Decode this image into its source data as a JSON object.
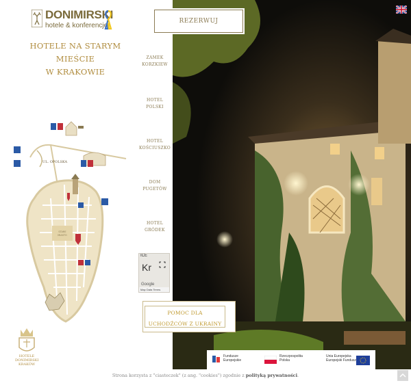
{
  "brand": {
    "name": "DONIMIRSKI",
    "tagline": "hotele & konferencje",
    "headline_line1": "HOTELE NA STARYM MIEŚCIE",
    "headline_line2": "W KRAKOWIE",
    "accent_color": "#b08c3e"
  },
  "map": {
    "street_label": "UL. OPOLSKA",
    "old_town_label_line1": "STARE",
    "old_town_label_line2": "MIASTO",
    "crest_caption_line1": "HOTELE",
    "crest_caption_line2": "DONIMIRSKI",
    "crest_caption_line3": "KRAKÓW"
  },
  "nav": {
    "items": [
      {
        "line1": "ZAMEK",
        "line2": "KORZKIEW"
      },
      {
        "line1": "HOTEL",
        "line2": "POLSKI"
      },
      {
        "line1": "HOTEL",
        "line2": "KOŚCIUSZKO"
      },
      {
        "line1": "DOM",
        "line2": "PUGETÓW"
      },
      {
        "line1": "HOTEL",
        "line2": "GRÓDEK"
      }
    ]
  },
  "mini_map": {
    "big_text": "Kr",
    "top_text": "ICE",
    "google_label": "Google",
    "footer": "Map Data   Terms"
  },
  "reserve_button": "REZERWUJ",
  "help_box": {
    "line1": "POMOC DLA",
    "line2": "UCHODŹCÓW Z UKRAINY"
  },
  "eu_logos": {
    "fundusze_line1": "Fundusze",
    "fundusze_line2": "Europejskie",
    "rp_line1": "Rzeczpospolita",
    "rp_line2": "Polska",
    "ue_line1": "Unia Europejska",
    "ue_line2": "Europejski Fundusz"
  },
  "cookie": {
    "text": "Strona korzysta z \"ciasteczek\" (z ang. \"cookies\") zgodnie z ",
    "link": "polityką prywatności",
    "end": "."
  },
  "icons": [
    "deer-logo-icon",
    "ukraine-ribbon-icon",
    "uk-flag-icon",
    "parking-icon",
    "hotel-icon",
    "expand-icon",
    "scroll-top-icon"
  ]
}
